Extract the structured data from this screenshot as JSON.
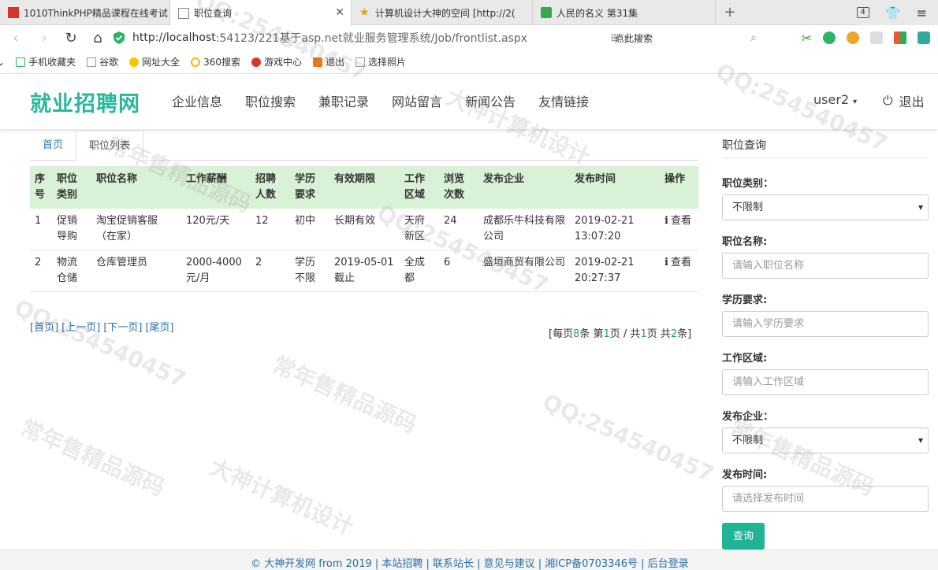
{
  "browser": {
    "tabs": [
      {
        "title": "1010ThinkPHP精品课程在线考试",
        "active": false
      },
      {
        "title": "职位查询",
        "active": true
      },
      {
        "title": "计算机设计大神的空间 [http://2(",
        "active": false
      },
      {
        "title": "人民的名义 第31集",
        "active": false
      }
    ],
    "tab_count": "4",
    "url_host": "http://localhost",
    "url_rest": ":54123/221基于asp.net就业服务管理系统/Job/frontlist.aspx",
    "search_hint": "点此搜索"
  },
  "bookmarks": [
    "手机收藏夹",
    "谷歌",
    "网址大全",
    "360搜索",
    "游戏中心",
    "退出",
    "选择照片"
  ],
  "site": {
    "logo": "就业招聘网",
    "nav": [
      "企业信息",
      "职位搜索",
      "兼职记录",
      "网站留言",
      "新闻公告",
      "友情链接"
    ],
    "user": "user2",
    "logout": "退出"
  },
  "breadcrumb": {
    "home": "首页",
    "current": "职位列表"
  },
  "table": {
    "headers": [
      "序号",
      "职位类别",
      "职位名称",
      "工作薪酬",
      "招聘人数",
      "学历要求",
      "有效期限",
      "工作区域",
      "浏览次数",
      "发布企业",
      "发布时间",
      "操作"
    ],
    "rows": [
      [
        "1",
        "促销导购",
        "淘宝促销客服（在家）",
        "120元/天",
        "12",
        "初中",
        "长期有效",
        "天府新区",
        "24",
        "成都乐牛科技有限公司",
        "2019-02-21 13:07:20",
        "查看"
      ],
      [
        "2",
        "物流仓储",
        "仓库管理员",
        "2000-4000元/月",
        "2",
        "学历不限",
        "2019-05-01截止",
        "全成都",
        "6",
        "盛垣商贸有限公司",
        "2019-02-21 20:27:37",
        "查看"
      ]
    ]
  },
  "pager": {
    "first": "[首页]",
    "prev": "[上一页]",
    "next": "[下一页]",
    "last": "[尾页]",
    "info_1": "[每页",
    "per_page": "8",
    "info_2": "条 第",
    "page": "1",
    "info_3": "页 / 共",
    "pages": "1",
    "info_4": "页 共",
    "total": "2",
    "info_5": "条]"
  },
  "sidebar": {
    "title": "职位查询",
    "job_type_label": "职位类别：",
    "job_type_value": "不限制",
    "job_name_label": "职位名称:",
    "job_name_placeholder": "请输入职位名称",
    "edu_label": "学历要求:",
    "edu_placeholder": "请输入学历要求",
    "area_label": "工作区域:",
    "area_placeholder": "请输入工作区域",
    "company_label": "发布企业：",
    "company_value": "不限制",
    "time_label": "发布时间:",
    "time_placeholder": "请选择发布时间",
    "search_button": "查询"
  },
  "footer": {
    "text": "© 大神开发网 from 2019 | 本站招聘 | 联系站长 | 意见与建议 | 湘ICP备0703346号 | 后台登录"
  },
  "watermarks": [
    "QQ:254540457",
    "大神计算机设计",
    "常年售精品源码"
  ]
}
